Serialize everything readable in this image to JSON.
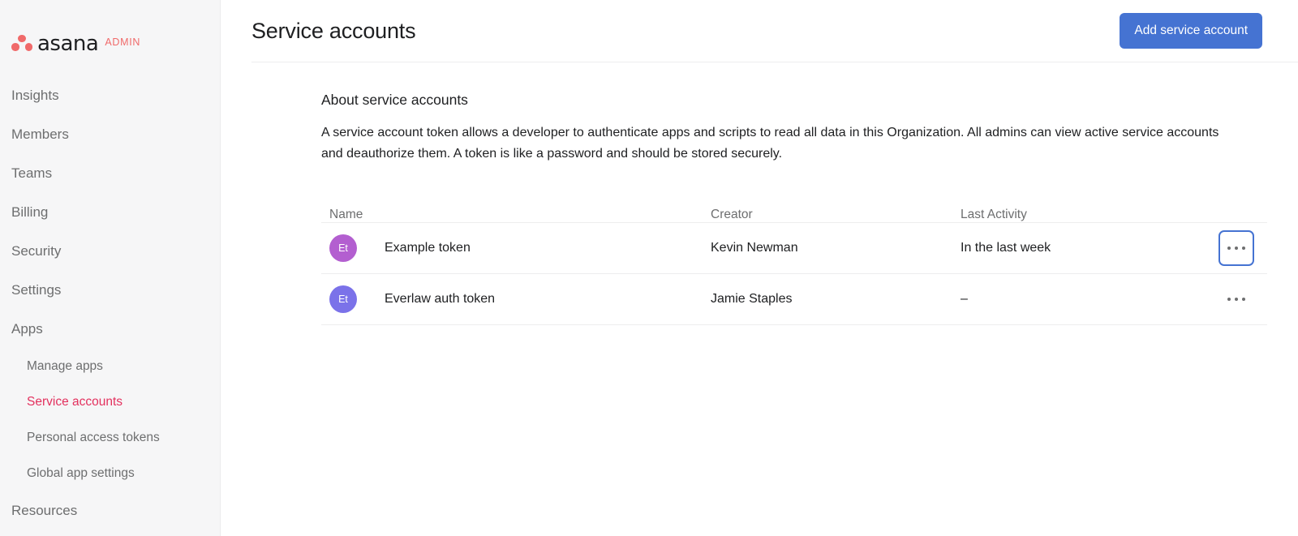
{
  "sidebar": {
    "brand": {
      "wordmark": "asana",
      "tag": "ADMIN",
      "logo_color": "#f06a6a"
    },
    "active_color": "#e3315e",
    "items": [
      {
        "label": "Insights",
        "sub": false,
        "active": false
      },
      {
        "label": "Members",
        "sub": false,
        "active": false
      },
      {
        "label": "Teams",
        "sub": false,
        "active": false
      },
      {
        "label": "Billing",
        "sub": false,
        "active": false
      },
      {
        "label": "Security",
        "sub": false,
        "active": false
      },
      {
        "label": "Settings",
        "sub": false,
        "active": false
      },
      {
        "label": "Apps",
        "sub": false,
        "active": false
      },
      {
        "label": "Manage apps",
        "sub": true,
        "active": false
      },
      {
        "label": "Service accounts",
        "sub": true,
        "active": true
      },
      {
        "label": "Personal access tokens",
        "sub": true,
        "active": false
      },
      {
        "label": "Global app settings",
        "sub": true,
        "active": false
      },
      {
        "label": "Resources",
        "sub": false,
        "active": false
      }
    ]
  },
  "header": {
    "title": "Service accounts",
    "add_button": "Add service account",
    "add_button_color": "#4573d2"
  },
  "about": {
    "title": "About service accounts",
    "body": "A service account token allows a developer to authenticate apps and scripts to read all data in this Organization. All admins can view active service accounts and deauthorize them. A token is like a password and should be stored securely."
  },
  "table": {
    "columns": {
      "name": "Name",
      "creator": "Creator",
      "activity": "Last Activity"
    },
    "rows": [
      {
        "initials": "Et",
        "avatar_color": "#b35fd0",
        "name": "Example token",
        "creator": "Kevin Newman",
        "activity": "In the last week",
        "menu_focused": true
      },
      {
        "initials": "Et",
        "avatar_color": "#7b72e9",
        "name": "Everlaw auth token",
        "creator": "Jamie Staples",
        "activity": "–",
        "menu_focused": false
      }
    ]
  }
}
